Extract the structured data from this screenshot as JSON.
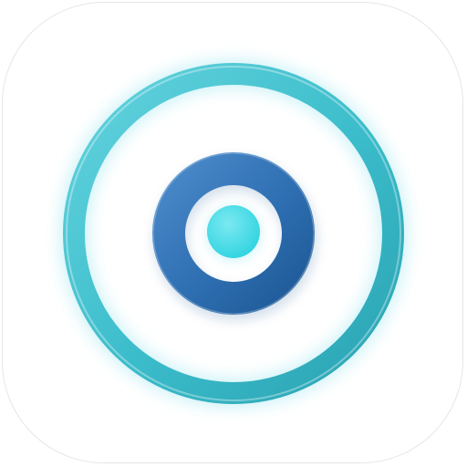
{
  "app_icon": {
    "icon_name": "target-rings-icon",
    "tile_color": "#ffffff",
    "tile_border_color": "#e6e6e6",
    "colors": {
      "outer_ring": "#3bbcca",
      "outer_ring_highlight": "#63d3de",
      "outer_ring_shade": "#2aa2b2",
      "glow": "#9ee6f0",
      "inner_ring": "#2e6fb2",
      "inner_ring_highlight": "#4a89c9",
      "inner_ring_shade": "#1f5a97",
      "center_dot": "#2fd3e0",
      "center_dot_highlight": "#7be9f1"
    }
  }
}
